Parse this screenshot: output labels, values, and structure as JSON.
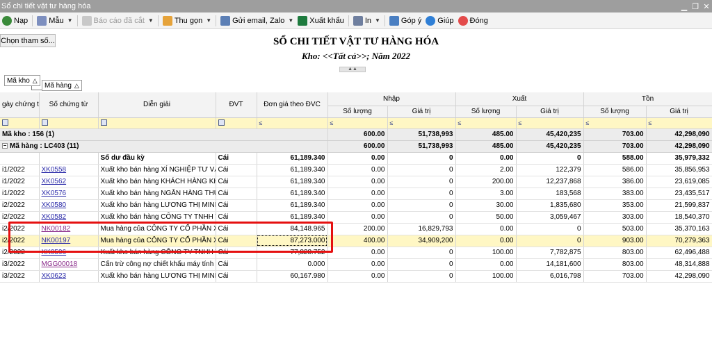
{
  "window": {
    "title": "Sổ chi tiết vật tư hàng hóa"
  },
  "toolbar": {
    "nap": "Nạp",
    "mau": "Mẫu",
    "bao_cao_da_cat": "Báo cáo đã cắt",
    "thu_gon": "Thu gọn",
    "gui_email": "Gửi email, Zalo",
    "xuat_khau": "Xuất khẩu",
    "in": "In",
    "gop_y": "Góp ý",
    "giup": "Giúp",
    "dong": "Đóng"
  },
  "chon_tham_so": "Chọn tham số...",
  "report": {
    "title": "SỔ CHI TIẾT VẬT TƯ HÀNG HÓA",
    "subtitle": "Kho: <<Tất cả>>; Năm 2022"
  },
  "grouping": {
    "chip1": "Mã kho",
    "chip2": "Mã hàng"
  },
  "columns": {
    "ngay": "gày chứng từ",
    "so_ct": "Số chứng từ",
    "dien_giai": "Diễn giải",
    "dvt": "ĐVT",
    "don_gia": "Đơn giá theo ĐVC",
    "nhap": "Nhập",
    "xuat": "Xuất",
    "ton": "Tồn",
    "so_luong": "Số lượng",
    "gia_tri": "Giá trị"
  },
  "filter_le": "≤",
  "group_kho": {
    "label": "Mã kho : 156 (1)",
    "nhap_sl": "600.00",
    "nhap_gt": "51,738,993",
    "xuat_sl": "485.00",
    "xuat_gt": "45,420,235",
    "ton_sl": "703.00",
    "ton_gt": "42,298,090"
  },
  "group_hang": {
    "label": "Mã hàng : LC403 (11)",
    "nhap_sl": "600.00",
    "nhap_gt": "51,738,993",
    "xuat_sl": "485.00",
    "xuat_gt": "45,420,235",
    "ton_sl": "703.00",
    "ton_gt": "42,298,090"
  },
  "rows": [
    {
      "ngay": "",
      "so": "",
      "dg": "Số dư đầu kỳ",
      "dvt": "Cái",
      "gia": "61,189.340",
      "nsl": "0.00",
      "ngt": "0",
      "xsl": "0.00",
      "xgt": "0",
      "tsl": "588.00",
      "tgt": "35,979,332"
    },
    {
      "ngay": "i1/2022",
      "so": "XK0558",
      "dg": "Xuất kho bán hàng XÍ NGHIỆP TƯ VẤN",
      "dvt": "Cái",
      "gia": "61,189.340",
      "nsl": "0.00",
      "ngt": "0",
      "xsl": "2.00",
      "xgt": "122,379",
      "tsl": "586.00",
      "tgt": "35,856,953"
    },
    {
      "ngay": "i1/2022",
      "so": "XK0562",
      "dg": "Xuất kho bán hàng KHÁCH HÀNG  KH",
      "dvt": "Cái",
      "gia": "61,189.340",
      "nsl": "0.00",
      "ngt": "0",
      "xsl": "200.00",
      "xgt": "12,237,868",
      "tsl": "386.00",
      "tgt": "23,619,085"
    },
    {
      "ngay": "i1/2022",
      "so": "XK0576",
      "dg": "Xuất kho bán hàng NGÂN HÀNG THƯƠ",
      "dvt": "Cái",
      "gia": "61,189.340",
      "nsl": "0.00",
      "ngt": "0",
      "xsl": "3.00",
      "xgt": "183,568",
      "tsl": "383.00",
      "tgt": "23,435,517"
    },
    {
      "ngay": "i2/2022",
      "so": "XK0580",
      "dg": "Xuất kho bán hàng LƯƠNG THỊ MINH",
      "dvt": "Cái",
      "gia": "61,189.340",
      "nsl": "0.00",
      "ngt": "0",
      "xsl": "30.00",
      "xgt": "1,835,680",
      "tsl": "353.00",
      "tgt": "21,599,837"
    },
    {
      "ngay": "i2/2022",
      "so": "XK0582",
      "dg": "Xuất kho bán hàng CÔNG TY TNHH T",
      "dvt": "Cái",
      "gia": "61,189.340",
      "nsl": "0.00",
      "ngt": "0",
      "xsl": "50.00",
      "xgt": "3,059,467",
      "tsl": "303.00",
      "tgt": "18,540,370"
    },
    {
      "ngay": "i2/2022",
      "so": "NK00182",
      "dg": "Mua hàng của CÔNG TY CỔ PHẦN XU",
      "dvt": "Cái",
      "gia": "84,148.965",
      "nsl": "200.00",
      "ngt": "16,829,793",
      "xsl": "0.00",
      "xgt": "0",
      "tsl": "503.00",
      "tgt": "35,370,163"
    },
    {
      "ngay": "i2/2022",
      "so": "NK00197",
      "dg": "Mua hàng của CÔNG TY CỔ PHẦN XU",
      "dvt": "Cái",
      "gia": "87,273.000",
      "nsl": "400.00",
      "ngt": "34,909,200",
      "xsl": "0.00",
      "xgt": "0",
      "tsl": "903.00",
      "tgt": "70,279,363"
    },
    {
      "ngay": "i2/2022",
      "so": "XK0596",
      "dg": "Xuất kho bán hàng CÔNG TY TNHH T",
      "dvt": "Cái",
      "gia": "77,828.752",
      "nsl": "0.00",
      "ngt": "0",
      "xsl": "100.00",
      "xgt": "7,782,875",
      "tsl": "803.00",
      "tgt": "62,496,488"
    },
    {
      "ngay": "i3/2022",
      "so": "MGG00018",
      "dg": "Cấn trừ công nợ chiết khấu máy tính thá",
      "dvt": "Cái",
      "gia": "0.000",
      "nsl": "0.00",
      "ngt": "0",
      "xsl": "0.00",
      "xgt": "14,181,600",
      "tsl": "803.00",
      "tgt": "48,314,888"
    },
    {
      "ngay": "i3/2022",
      "so": "XK0623",
      "dg": "Xuất kho bán hàng LƯƠNG THỊ MINH",
      "dvt": "Cái",
      "gia": "60,167.980",
      "nsl": "0.00",
      "ngt": "0",
      "xsl": "100.00",
      "xgt": "6,016,798",
      "tsl": "703.00",
      "tgt": "42,298,090"
    }
  ],
  "colors": {
    "filter_row": "#fff7c4",
    "highlight_border": "#e51010",
    "link": "#2a2aa8"
  }
}
